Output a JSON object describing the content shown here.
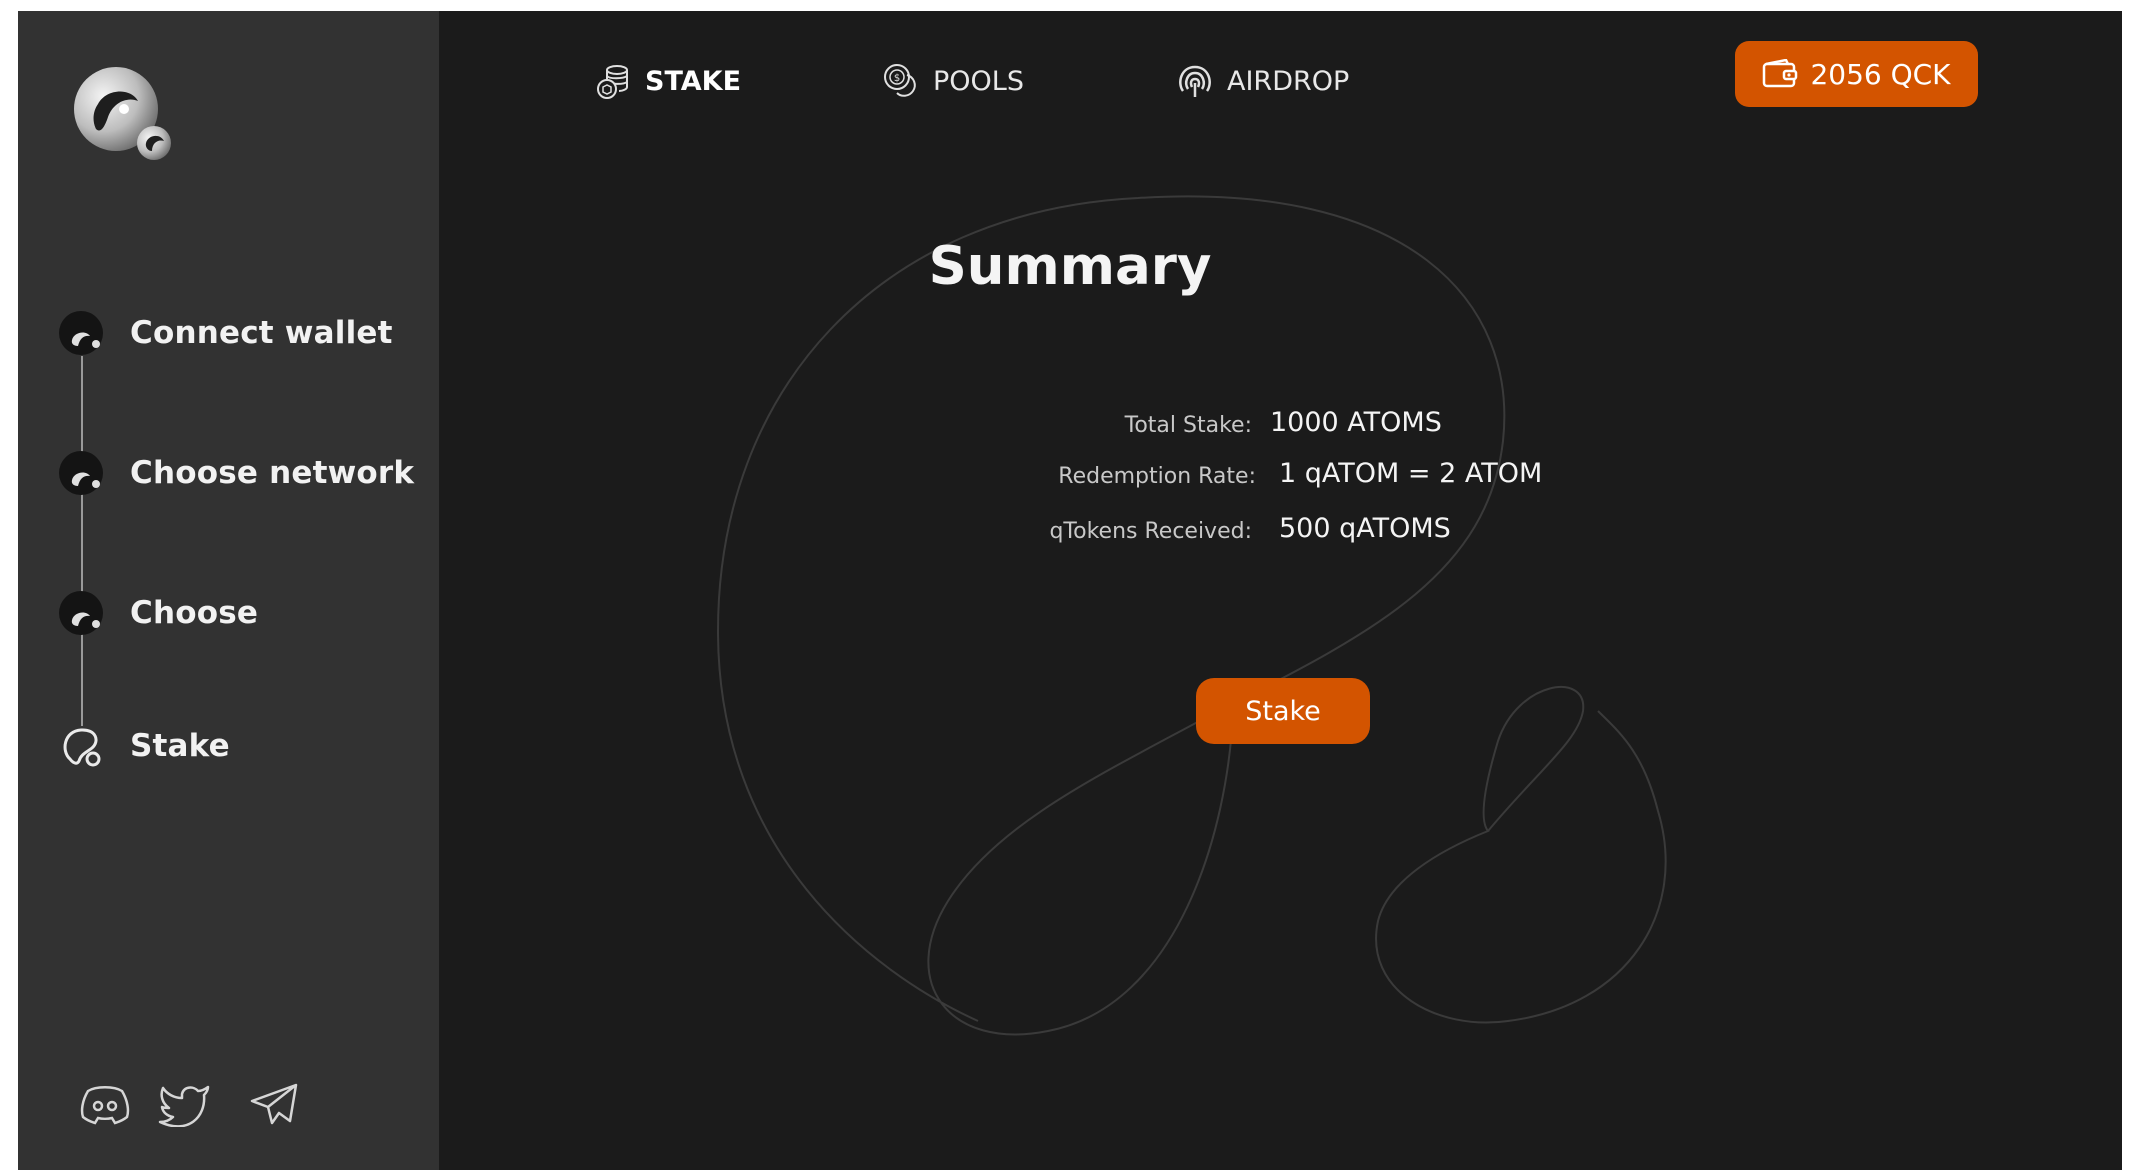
{
  "sidebar": {
    "logo": "quicksilver-logo",
    "steps": [
      {
        "label": "Connect wallet",
        "icon": "step-complete-icon"
      },
      {
        "label": "Choose network",
        "icon": "step-complete-icon"
      },
      {
        "label": "Choose",
        "icon": "step-complete-icon"
      },
      {
        "label": "Stake",
        "icon": "step-current-icon"
      }
    ],
    "social": [
      "discord-icon",
      "twitter-icon",
      "telegram-icon"
    ]
  },
  "nav": {
    "items": [
      {
        "label": "STAKE",
        "icon": "coins-stack-icon",
        "active": true
      },
      {
        "label": "POOLS",
        "icon": "coins-icon",
        "active": false
      },
      {
        "label": "AIRDROP",
        "icon": "airdrop-icon",
        "active": false
      }
    ],
    "balance": "2056 QCK",
    "balance_icon": "wallet-icon"
  },
  "summary": {
    "title": "Summary",
    "rows": [
      {
        "key": "Total Stake:",
        "value": "1000 ATOMS"
      },
      {
        "key": "Redemption Rate:",
        "value": "1 qATOM = 2 ATOM"
      },
      {
        "key": "qTokens Received:",
        "value": "500 qATOMS"
      }
    ],
    "stake_button": "Stake"
  },
  "colors": {
    "accent": "#d35400",
    "sidebar": "#323232",
    "background": "#1b1b1b"
  }
}
